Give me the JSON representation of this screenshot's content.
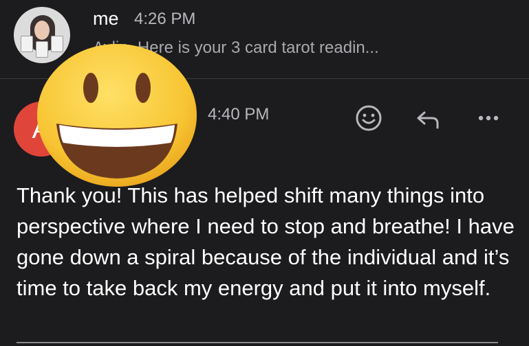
{
  "thread": {
    "first": {
      "sender": "me",
      "time": "4:26 PM",
      "preview": "Aylin, Here is your 3 card tarot readin..."
    },
    "second": {
      "avatar_letter": "A",
      "sender_fragment": ")",
      "time": "4:40 PM",
      "body": "Thank you! This has helped shift many things into perspective where I need to stop and breathe! I have gone down a spiral because of the individual and it’s time to take back my energy and put it into myself."
    }
  },
  "actions": {
    "react_icon": "smiley-react-icon",
    "reply_icon": "reply-arrow-icon",
    "more_icon": "more-options-icon"
  },
  "overlay": {
    "icon": "grinning-face-emoji",
    "color_face": "#f7c533",
    "color_features": "#6b3a1e"
  },
  "colors": {
    "background": "#1c1c1e",
    "avatar_other": "#e0453a",
    "secondary_text": "#b8b8bd"
  }
}
